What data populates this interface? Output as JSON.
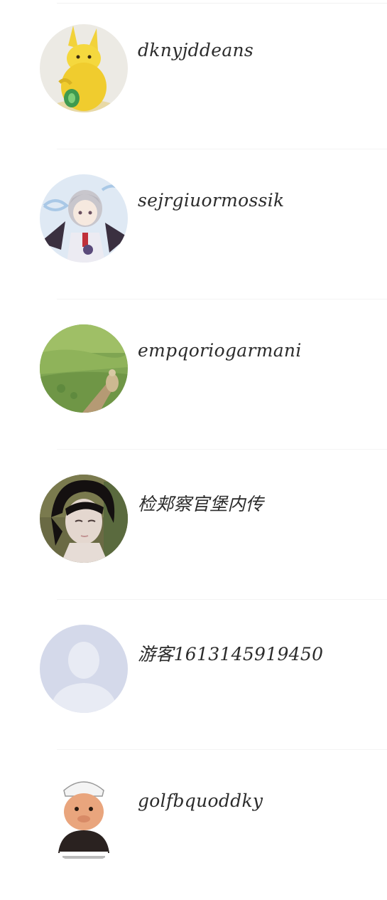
{
  "users": [
    {
      "name": "dknyjddeans",
      "avatar_icon": "yellow-creature-avatar-icon"
    },
    {
      "name": "sejrgiuormossik",
      "avatar_icon": "anime-character-avatar-icon"
    },
    {
      "name": "empqoriogarmani",
      "avatar_icon": "green-field-avatar-icon"
    },
    {
      "name": "检郏察官堡内传",
      "avatar_icon": "dark-hair-doll-avatar-icon"
    },
    {
      "name": "游客1613145919450",
      "avatar_icon": "default-person-avatar-icon"
    },
    {
      "name": "golfbquoddky",
      "avatar_icon": "cartoon-man-avatar-icon"
    }
  ],
  "colors": {
    "text": "#2b2b2b",
    "default_avatar_bg": "#d4d9ea"
  }
}
